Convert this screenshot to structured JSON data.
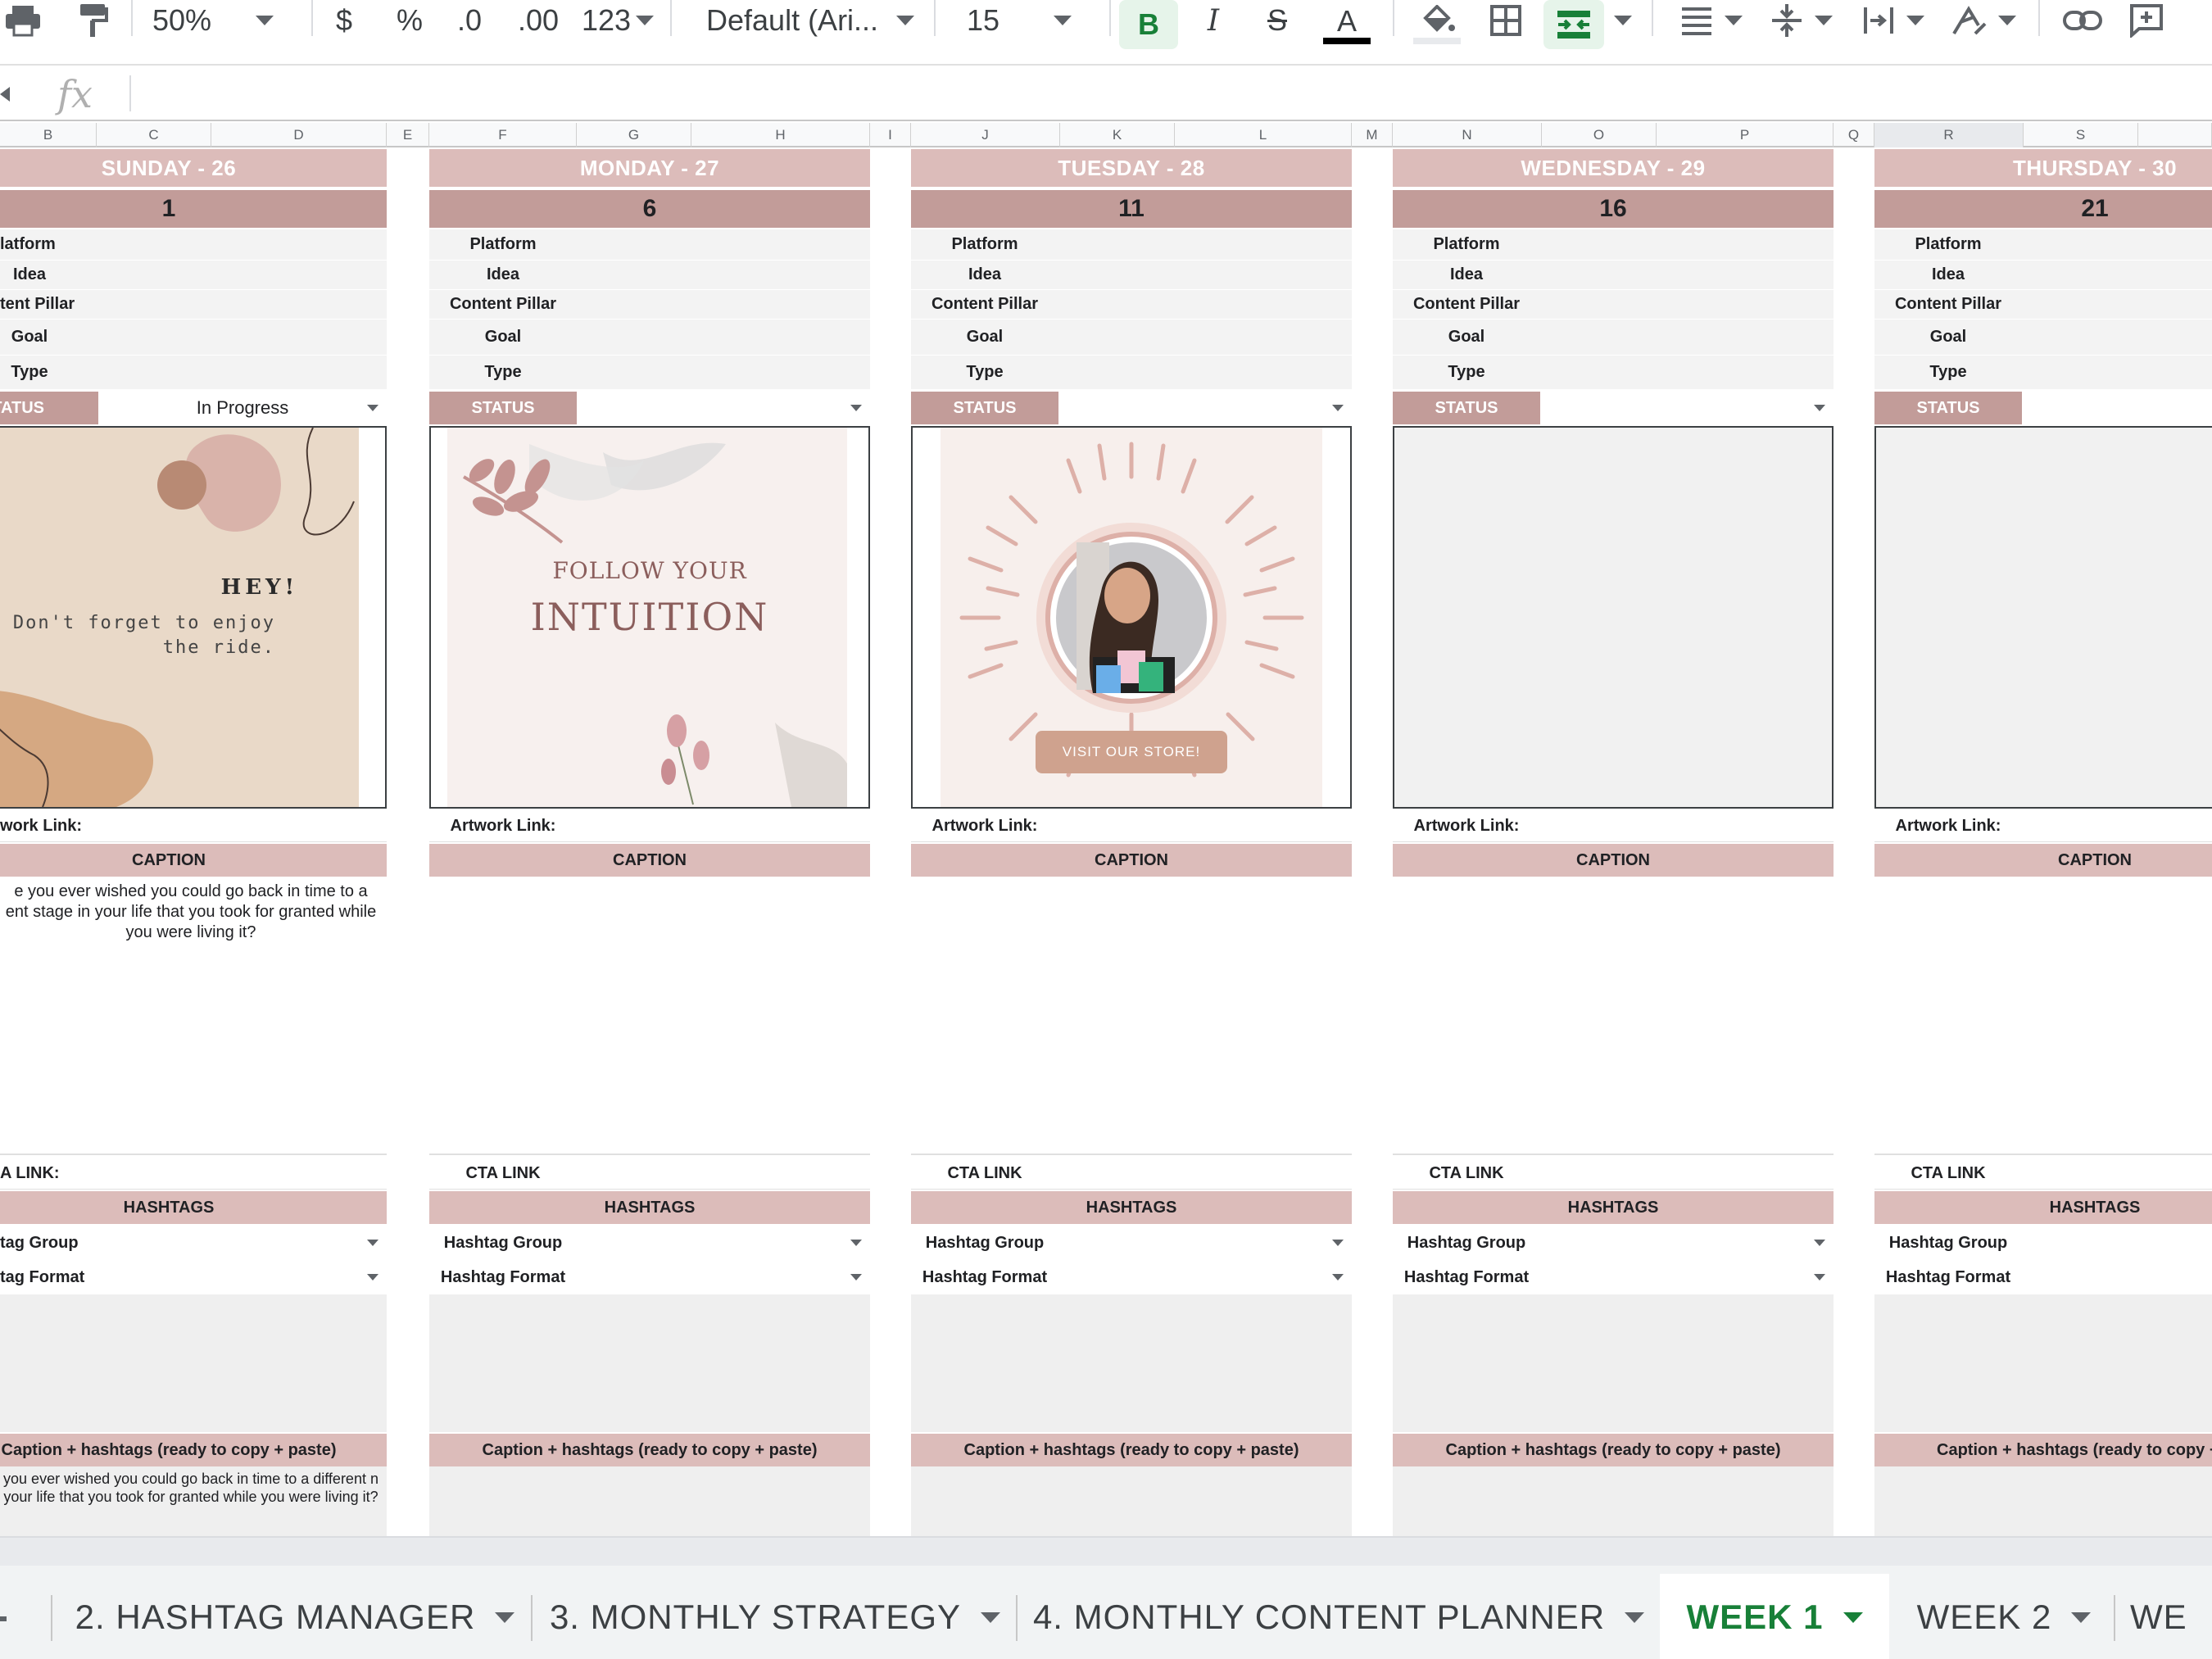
{
  "toolbar": {
    "zoom": "50%",
    "currency": "$",
    "percent": "%",
    "decrease_decimals": ".0",
    "increase_decimals": ".00",
    "number_format": "123",
    "font": "Default (Ari...",
    "font_size": "15",
    "bold": "B",
    "italic": "I",
    "strikethrough": "S",
    "text_color": "A",
    "colors": {
      "accent_green": "#188038",
      "text_color_bar": "#000000"
    }
  },
  "formula_bar": {
    "fx_label": "fx",
    "value": ""
  },
  "columns": [
    "B",
    "C",
    "D",
    "E",
    "F",
    "G",
    "H",
    "I",
    "J",
    "K",
    "L",
    "M",
    "N",
    "O",
    "P",
    "Q",
    "R",
    "S"
  ],
  "labels": {
    "platform": "Platform",
    "idea": "Idea",
    "content_pillar": "Content Pillar",
    "goal": "Goal",
    "type": "Type",
    "status": "STATUS",
    "artwork_link": "Artwork Link:",
    "caption": "CAPTION",
    "cta_link": "CTA LINK",
    "hashtags": "HASHTAGS",
    "hashtag_group": "Hashtag Group",
    "hashtag_format": "Hashtag Format",
    "copy_paste": "Caption + hashtags (ready to copy + paste)"
  },
  "first_col_labels": {
    "platform": "latform",
    "idea": "Idea",
    "content_pillar": "tent Pillar",
    "goal": "Goal",
    "type": "Type",
    "status": "TATUS",
    "artwork_link": "work Link:",
    "cta_link": "A LINK:",
    "hashtag_group": "tag Group",
    "hashtag_format": "tag Format"
  },
  "days": [
    {
      "title": "SUNDAY - 26",
      "number": "1",
      "status": "In Progress",
      "caption": "e you ever wished you could go back in time to a ent stage in your life that you took for granted while you were living it?",
      "copy": "you ever wished you could go back in time to a different n your life that you took for granted while you were living it?"
    },
    {
      "title": "MONDAY - 27",
      "number": "6",
      "status": "",
      "caption": "",
      "copy": ""
    },
    {
      "title": "TUESDAY - 28",
      "number": "11",
      "status": "",
      "caption": "",
      "copy": ""
    },
    {
      "title": "WEDNESDAY - 29",
      "number": "16",
      "status": "",
      "caption": "",
      "copy": ""
    },
    {
      "title": "THURSDAY - 30",
      "number": "21",
      "status": "",
      "caption": "",
      "copy": ""
    }
  ],
  "thursday_copy_label": "Caption + hashtags (ready to copy + p",
  "artwork": {
    "sunday": {
      "heading": "HEY!",
      "line1": "Don't forget to enjoy",
      "line2": "the ride."
    },
    "monday": {
      "line1": "FOLLOW YOUR",
      "line2": "INTUITION"
    },
    "tuesday": {
      "button": "VISIT OUR STORE!"
    }
  },
  "sheet_tabs": [
    {
      "label": "2. HASHTAG MANAGER",
      "active": false
    },
    {
      "label": "3. MONTHLY STRATEGY",
      "active": false
    },
    {
      "label": "4. MONTHLY CONTENT PLANNER",
      "active": false
    },
    {
      "label": "WEEK 1",
      "active": true
    },
    {
      "label": "WEEK 2",
      "active": false
    },
    {
      "label": "WE",
      "active": false
    }
  ],
  "palette": {
    "day_title_bg": "#dcbcba",
    "day_number_bg": "#c29c99",
    "status_bg": "#c29c99",
    "field_bg": "#f3f3f3"
  }
}
